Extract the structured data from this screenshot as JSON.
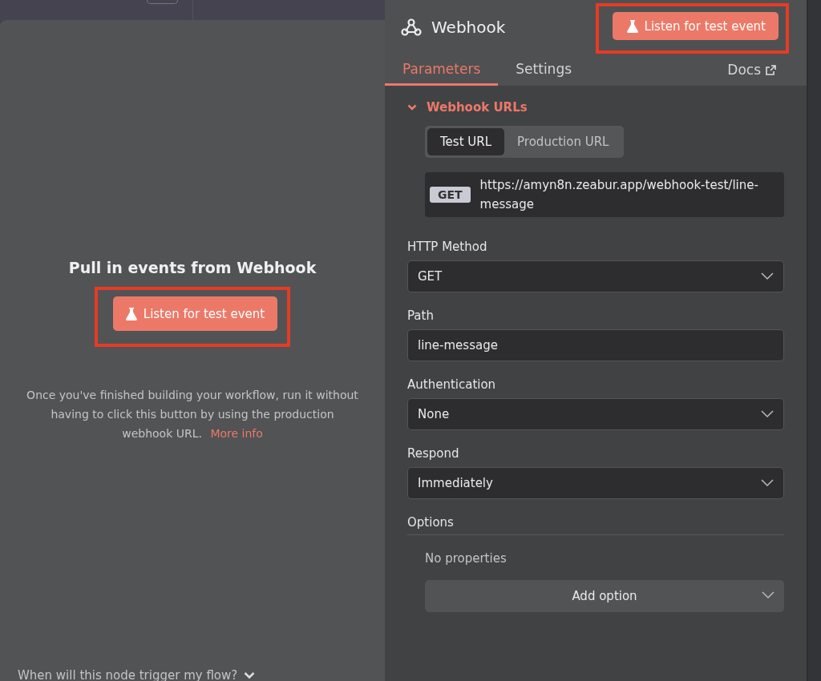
{
  "left_panel": {
    "heading": "Pull in events from Webhook",
    "listen_button": {
      "label": "Listen for test event",
      "highlighted": true
    },
    "description": "Once you've finished building your workflow, run it without having to click this button by using the production webhook URL.",
    "more_info_link": "More info",
    "footer_toggle": {
      "label": "When will this node trigger my flow?",
      "expanded": false
    }
  },
  "node_panel": {
    "title": "Webhook",
    "listen_button": {
      "label": "Listen for test event",
      "highlighted": true
    },
    "tabs": [
      {
        "label": "Parameters",
        "selected": true
      },
      {
        "label": "Settings",
        "selected": false
      }
    ],
    "docs_link": "Docs",
    "webhook_urls": {
      "title": "Webhook URLs",
      "expanded": true,
      "url_tabs": [
        {
          "label": "Test URL",
          "selected": true
        },
        {
          "label": "Production URL",
          "selected": false
        }
      ],
      "method": "GET",
      "url": "https://amyn8n.zeabur.app/webhook-test/line-message"
    },
    "fields": [
      {
        "kind": "select",
        "label": "HTTP Method",
        "value": "GET"
      },
      {
        "kind": "text",
        "label": "Path",
        "value": "line-message"
      },
      {
        "kind": "select",
        "label": "Authentication",
        "value": "None"
      },
      {
        "kind": "select",
        "label": "Respond",
        "value": "Immediately"
      }
    ],
    "options": {
      "title": "Options",
      "empty_text": "No properties",
      "add_button": "Add option"
    }
  }
}
